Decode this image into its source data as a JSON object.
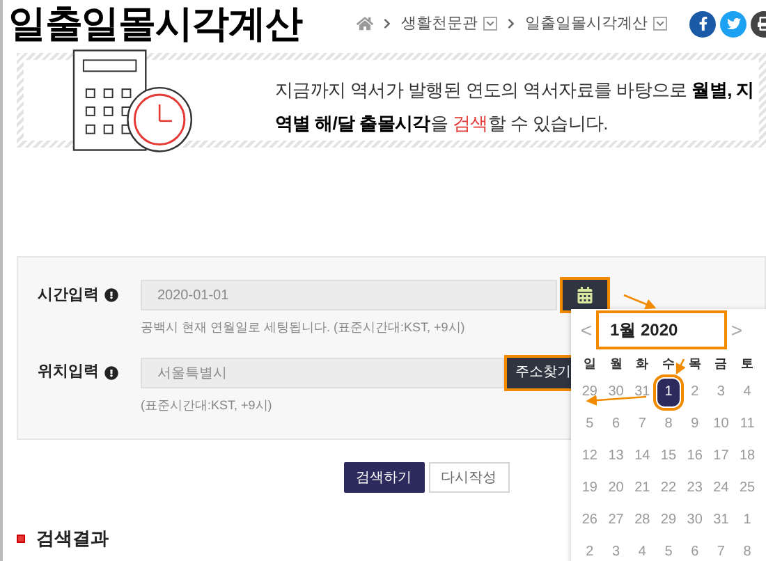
{
  "page_title": "일출일몰시각계산",
  "breadcrumb": [
    {
      "label": "생활천문관"
    },
    {
      "label": "일출일몰시각계산"
    }
  ],
  "intro": [
    {
      "text": "지금까지 역서가 발행된 연도의 역서자료를 바탕으로 ",
      "kind": "plain"
    },
    {
      "text": "월별, 지역별 해/달 출몰시각",
      "kind": "bold"
    },
    {
      "text": "을 ",
      "kind": "plain"
    },
    {
      "text": "검색",
      "kind": "accent"
    },
    {
      "text": "할 수 있습니다.",
      "kind": "plain"
    }
  ],
  "fields": [
    {
      "kind": "date",
      "label": "시간입력",
      "value": "2020-01-01",
      "hint": "공백시 현재 연월일로 세팅됩니다. (표준시간대:KST, +9시)",
      "highlighted": true
    },
    {
      "kind": "address",
      "label": "위치입력",
      "value": "서울특별시",
      "hint": "(표준시간대:KST, +9시)",
      "button": "주소찾기",
      "highlighted": true
    }
  ],
  "calendar": {
    "prev": "<",
    "next": ">",
    "month": "1월 2020",
    "month_highlighted": true,
    "weekdays": [
      "일",
      "월",
      "화",
      "수",
      "목",
      "금",
      "토"
    ],
    "weeks": [
      [
        {
          "day": "29",
          "selected": false
        },
        {
          "day": "30",
          "selected": false
        },
        {
          "day": "31",
          "selected": false
        },
        {
          "day": "1",
          "selected": true
        },
        {
          "day": "2",
          "selected": false
        },
        {
          "day": "3",
          "selected": false
        },
        {
          "day": "4",
          "selected": false
        }
      ],
      [
        {
          "day": "5",
          "selected": false
        },
        {
          "day": "6",
          "selected": false
        },
        {
          "day": "7",
          "selected": false
        },
        {
          "day": "8",
          "selected": false
        },
        {
          "day": "9",
          "selected": false
        },
        {
          "day": "10",
          "selected": false
        },
        {
          "day": "11",
          "selected": false
        }
      ],
      [
        {
          "day": "12",
          "selected": false
        },
        {
          "day": "13",
          "selected": false
        },
        {
          "day": "14",
          "selected": false
        },
        {
          "day": "15",
          "selected": false
        },
        {
          "day": "16",
          "selected": false
        },
        {
          "day": "17",
          "selected": false
        },
        {
          "day": "18",
          "selected": false
        }
      ],
      [
        {
          "day": "19",
          "selected": false
        },
        {
          "day": "20",
          "selected": false
        },
        {
          "day": "21",
          "selected": false
        },
        {
          "day": "22",
          "selected": false
        },
        {
          "day": "23",
          "selected": false
        },
        {
          "day": "24",
          "selected": false
        },
        {
          "day": "25",
          "selected": false
        }
      ],
      [
        {
          "day": "26",
          "selected": false
        },
        {
          "day": "27",
          "selected": false
        },
        {
          "day": "28",
          "selected": false
        },
        {
          "day": "29",
          "selected": false
        },
        {
          "day": "30",
          "selected": false
        },
        {
          "day": "31",
          "selected": false
        },
        {
          "day": "1",
          "selected": false
        }
      ],
      [
        {
          "day": "2",
          "selected": false
        },
        {
          "day": "3",
          "selected": false
        },
        {
          "day": "4",
          "selected": false
        },
        {
          "day": "5",
          "selected": false
        },
        {
          "day": "6",
          "selected": false
        },
        {
          "day": "7",
          "selected": false
        },
        {
          "day": "8",
          "selected": false
        }
      ]
    ]
  },
  "buttons": [
    {
      "kind": "primary",
      "label": "검색하기"
    },
    {
      "kind": "secondary",
      "label": "다시작성"
    }
  ],
  "results_heading": "검색결과"
}
